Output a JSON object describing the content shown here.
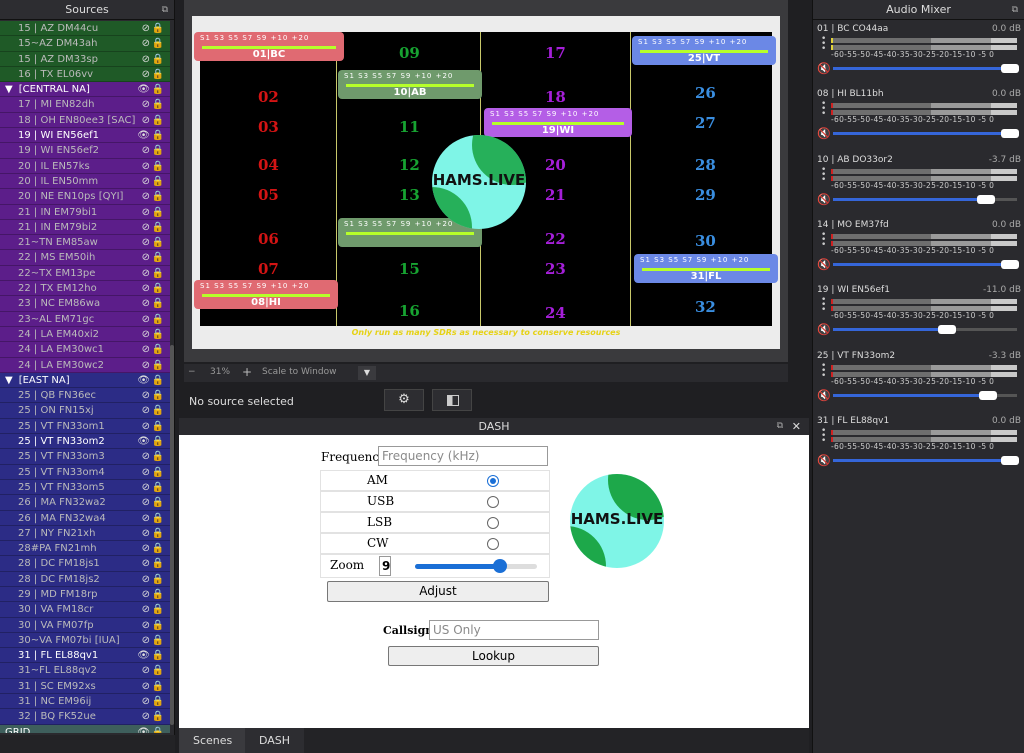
{
  "sources": {
    "title": "Sources",
    "items": [
      {
        "label": "15 | AZ DM44cu",
        "color": "grn",
        "type": "src",
        "vis": "hidden"
      },
      {
        "label": "15~AZ DM43ah",
        "color": "grn",
        "type": "src",
        "vis": "hidden"
      },
      {
        "label": "15 | AZ DM33sp",
        "color": "grn",
        "type": "src",
        "vis": "hidden"
      },
      {
        "label": "16 | TX EL06vv",
        "color": "grn",
        "type": "src",
        "vis": "hidden"
      },
      {
        "label": "[CENTRAL NA]",
        "color": "pur",
        "type": "grp",
        "vis": "visible"
      },
      {
        "label": "17 | MI EN82dh",
        "color": "pur",
        "type": "src",
        "vis": "hidden"
      },
      {
        "label": "18 | OH EN80ee3 [SAC]",
        "color": "pur",
        "type": "src",
        "vis": "hidden"
      },
      {
        "label": "19 | WI EN56ef1",
        "color": "pur",
        "type": "src",
        "vis": "visible"
      },
      {
        "label": "19 | WI EN56ef2",
        "color": "pur",
        "type": "src",
        "vis": "hidden"
      },
      {
        "label": "20 | IL EN57ks",
        "color": "pur",
        "type": "src",
        "vis": "hidden"
      },
      {
        "label": "20 | IL EN50mm",
        "color": "pur",
        "type": "src",
        "vis": "hidden"
      },
      {
        "label": "20 | NE EN10ps [QYI]",
        "color": "pur",
        "type": "src",
        "vis": "hidden"
      },
      {
        "label": "21 | IN EM79bi1",
        "color": "pur",
        "type": "src",
        "vis": "hidden"
      },
      {
        "label": "21 | IN EM79bi2",
        "color": "pur",
        "type": "src",
        "vis": "hidden"
      },
      {
        "label": "21~TN EM85aw",
        "color": "pur",
        "type": "src",
        "vis": "hidden"
      },
      {
        "label": "22 | MS EM50ih",
        "color": "pur",
        "type": "src",
        "vis": "hidden"
      },
      {
        "label": "22~TX EM13pe",
        "color": "pur",
        "type": "src",
        "vis": "hidden"
      },
      {
        "label": "22 | TX EM12ho",
        "color": "pur",
        "type": "src",
        "vis": "hidden"
      },
      {
        "label": "23 | NC EM86wa",
        "color": "pur",
        "type": "src",
        "vis": "hidden"
      },
      {
        "label": "23~AL EM71gc",
        "color": "pur",
        "type": "src",
        "vis": "hidden"
      },
      {
        "label": "24 | LA EM40xi2",
        "color": "pur",
        "type": "src",
        "vis": "hidden"
      },
      {
        "label": "24 | LA EM30wc1",
        "color": "pur",
        "type": "src",
        "vis": "hidden"
      },
      {
        "label": "24 | LA EM30wc2",
        "color": "pur",
        "type": "src",
        "vis": "hidden"
      },
      {
        "label": "[EAST NA]",
        "color": "blu",
        "type": "grp",
        "vis": "visible"
      },
      {
        "label": "25 | QB FN36ec",
        "color": "blu",
        "type": "src",
        "vis": "hidden"
      },
      {
        "label": "25 | ON FN15xj",
        "color": "blu",
        "type": "src",
        "vis": "hidden"
      },
      {
        "label": "25 | VT FN33om1",
        "color": "blu",
        "type": "src",
        "vis": "hidden"
      },
      {
        "label": "25 | VT FN33om2",
        "color": "blu",
        "type": "src",
        "vis": "visible"
      },
      {
        "label": "25 | VT FN33om3",
        "color": "blu",
        "type": "src",
        "vis": "hidden"
      },
      {
        "label": "25 | VT FN33om4",
        "color": "blu",
        "type": "src",
        "vis": "hidden"
      },
      {
        "label": "25 | VT FN33om5",
        "color": "blu",
        "type": "src",
        "vis": "hidden"
      },
      {
        "label": "26 | MA FN32wa2",
        "color": "blu",
        "type": "src",
        "vis": "hidden"
      },
      {
        "label": "26 | MA FN32wa4",
        "color": "blu",
        "type": "src",
        "vis": "hidden"
      },
      {
        "label": "27 | NY FN21xh",
        "color": "blu",
        "type": "src",
        "vis": "hidden"
      },
      {
        "label": "28#PA FN21mh",
        "color": "blu",
        "type": "src",
        "vis": "hidden"
      },
      {
        "label": "28 | DC FM18js1",
        "color": "blu",
        "type": "src",
        "vis": "hidden"
      },
      {
        "label": "28 | DC FM18js2",
        "color": "blu",
        "type": "src",
        "vis": "hidden"
      },
      {
        "label": "29 | MD FM18rp",
        "color": "blu",
        "type": "src",
        "vis": "hidden"
      },
      {
        "label": "30 | VA FM18cr",
        "color": "blu",
        "type": "src",
        "vis": "hidden"
      },
      {
        "label": "30 | VA FM07fp",
        "color": "blu",
        "type": "src",
        "vis": "hidden"
      },
      {
        "label": "30~VA FM07bi [IUA]",
        "color": "blu",
        "type": "src",
        "vis": "hidden"
      },
      {
        "label": "31 | FL EL88qv1",
        "color": "blu",
        "type": "src",
        "vis": "visible"
      },
      {
        "label": "31~FL EL88qv2",
        "color": "blu",
        "type": "src",
        "vis": "hidden"
      },
      {
        "label": "31 | SC EM92xs",
        "color": "blu",
        "type": "src",
        "vis": "hidden"
      },
      {
        "label": "31 | NC EM96ij",
        "color": "blu",
        "type": "src",
        "vis": "hidden"
      },
      {
        "label": "32 | BQ FK52ue",
        "color": "blu",
        "type": "src",
        "vis": "hidden"
      },
      {
        "label": "GRID",
        "color": "tea",
        "type": "grp2",
        "vis": "visible"
      }
    ]
  },
  "preview": {
    "numbers": [
      {
        "t": "02",
        "c": "red"
      },
      {
        "t": "03",
        "c": "red"
      },
      {
        "t": "04",
        "c": "red"
      },
      {
        "t": "05",
        "c": "red"
      },
      {
        "t": "06",
        "c": "red"
      },
      {
        "t": "07",
        "c": "red"
      },
      {
        "t": "09",
        "c": "gr"
      },
      {
        "t": "11",
        "c": "gr"
      },
      {
        "t": "12",
        "c": "gr"
      },
      {
        "t": "13",
        "c": "gr"
      },
      {
        "t": "15",
        "c": "gr"
      },
      {
        "t": "16",
        "c": "gr"
      },
      {
        "t": "17",
        "c": "pu"
      },
      {
        "t": "18",
        "c": "pu"
      },
      {
        "t": "20",
        "c": "pu"
      },
      {
        "t": "21",
        "c": "pu"
      },
      {
        "t": "22",
        "c": "pu"
      },
      {
        "t": "23",
        "c": "pu"
      },
      {
        "t": "24",
        "c": "pu"
      },
      {
        "t": "26",
        "c": "bl"
      },
      {
        "t": "27",
        "c": "bl"
      },
      {
        "t": "28",
        "c": "bl"
      },
      {
        "t": "29",
        "c": "bl"
      },
      {
        "t": "30",
        "c": "bl"
      },
      {
        "t": "32",
        "c": "bl"
      }
    ],
    "meter_ticks": "S1  S3  S5  S7  S9 +10 +20",
    "meters": [
      {
        "label": "01|BC",
        "bg": "#e06a72"
      },
      {
        "label": "10|AB",
        "bg": "#6f9a6c"
      },
      {
        "label": "19|WI",
        "bg": "#b45ee6"
      },
      {
        "label": "25|VT",
        "bg": "#6b88e6"
      },
      {
        "label": "31|FL",
        "bg": "#6b88e6"
      },
      {
        "label": "08|HI",
        "bg": "#e06a72"
      },
      {
        "label": "",
        "bg": "#6f9a6c"
      }
    ],
    "logo_text": "HAMS.LIVE",
    "warning": "Only run as many SDRs as necessary to conserve resources"
  },
  "zoombar": {
    "zoom": "31%",
    "scale": "Scale to Window",
    "minus": "−",
    "plus": "+"
  },
  "status": {
    "text": "No source selected"
  },
  "dash": {
    "title": "DASH",
    "frequency_label": "Frequency",
    "frequency_placeholder": "Frequency (kHz)",
    "modes": [
      "AM",
      "USB",
      "LSB",
      "CW"
    ],
    "selected_mode": "AM",
    "zoom_label": "Zoom",
    "zoom_value": "9",
    "zoom_percent": 70,
    "adjust_label": "Adjust",
    "callsign_label": "Callsign",
    "callsign_placeholder": "US Only",
    "lookup_label": "Lookup",
    "logo_text": "HAMS.LIVE"
  },
  "tabs": {
    "scenes": "Scenes",
    "dash": "DASH"
  },
  "mixer": {
    "title": "Audio Mixer",
    "scale": "-60-55-50-45-40-35-30-25-20-15-10 -5  0",
    "channels": [
      {
        "name": "01 | BC CO44aa",
        "db": "0.0 dB",
        "level": 96
      },
      {
        "name": "08 | HI BL11bh",
        "db": "0.0 dB",
        "level": 96
      },
      {
        "name": "10 | AB DO33or2",
        "db": "-3.7 dB",
        "level": 83
      },
      {
        "name": "14 | MO EM37fd",
        "db": "0.0 dB",
        "level": 96
      },
      {
        "name": "19 | WI EN56ef1",
        "db": "-11.0 dB",
        "level": 62
      },
      {
        "name": "25 | VT FN33om2",
        "db": "-3.3 dB",
        "level": 84
      },
      {
        "name": "31 | FL EL88qv1",
        "db": "0.0 dB",
        "level": 96
      }
    ]
  }
}
